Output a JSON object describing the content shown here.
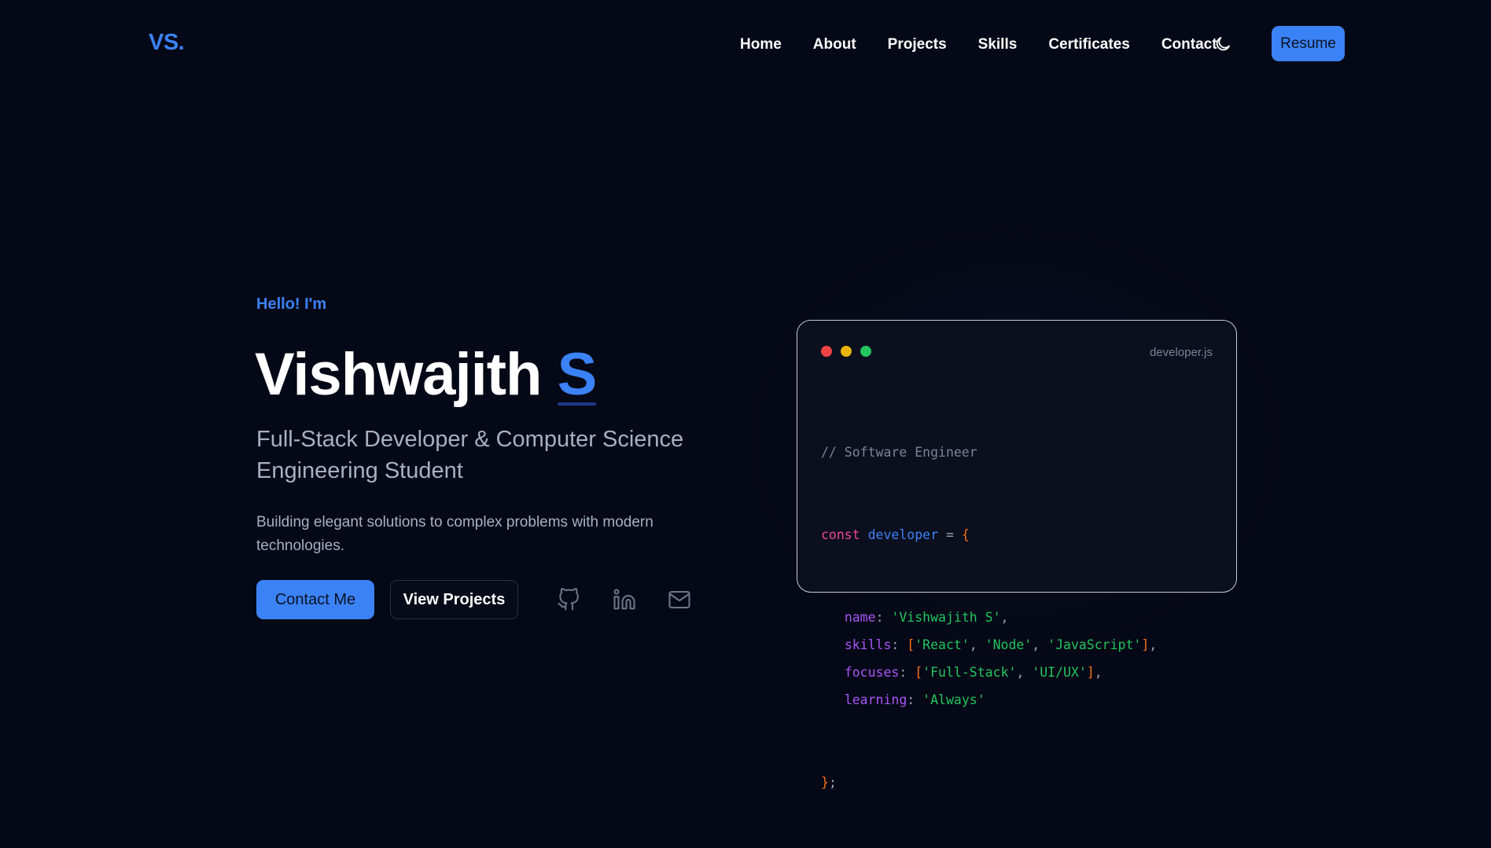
{
  "nav": {
    "logo": "VS.",
    "links": [
      "Home",
      "About",
      "Projects",
      "Skills",
      "Certificates",
      "Contact"
    ],
    "theme_icon": "moon-icon",
    "resume_label": "Resume"
  },
  "hero": {
    "greeting": "Hello! I'm",
    "name_first": "Vishwajith",
    "name_accent": "S",
    "title": "Full-Stack Developer & Computer Science Engineering Student",
    "description": "Building elegant solutions to complex problems with modern technologies.",
    "contact_button": "Contact Me",
    "projects_button": "View Projects",
    "social_icons": [
      "github-icon",
      "linkedin-icon",
      "mail-icon"
    ]
  },
  "code_card": {
    "filename": "developer.js",
    "window_dots": [
      "#ef4444",
      "#eab308",
      "#22c55e"
    ],
    "comment": "// Software Engineer",
    "keyword": "const",
    "var_name": "developer",
    "assign": " = ",
    "open_brace": "{",
    "close": "}",
    "semicolon": ";",
    "fields": [
      {
        "key": "name",
        "values": [
          "'Vishwajith S'"
        ],
        "array": false
      },
      {
        "key": "skills",
        "values": [
          "'React'",
          "'Node'",
          "'JavaScript'"
        ],
        "array": true
      },
      {
        "key": "focuses",
        "values": [
          "'Full-Stack'",
          "'UI/UX'"
        ],
        "array": true
      },
      {
        "key": "learning",
        "values": [
          "'Always'"
        ],
        "array": false,
        "last": true
      }
    ]
  },
  "colors": {
    "background": "#050816",
    "accent": "#3b82f6",
    "muted_text": "#a7b0c4"
  }
}
